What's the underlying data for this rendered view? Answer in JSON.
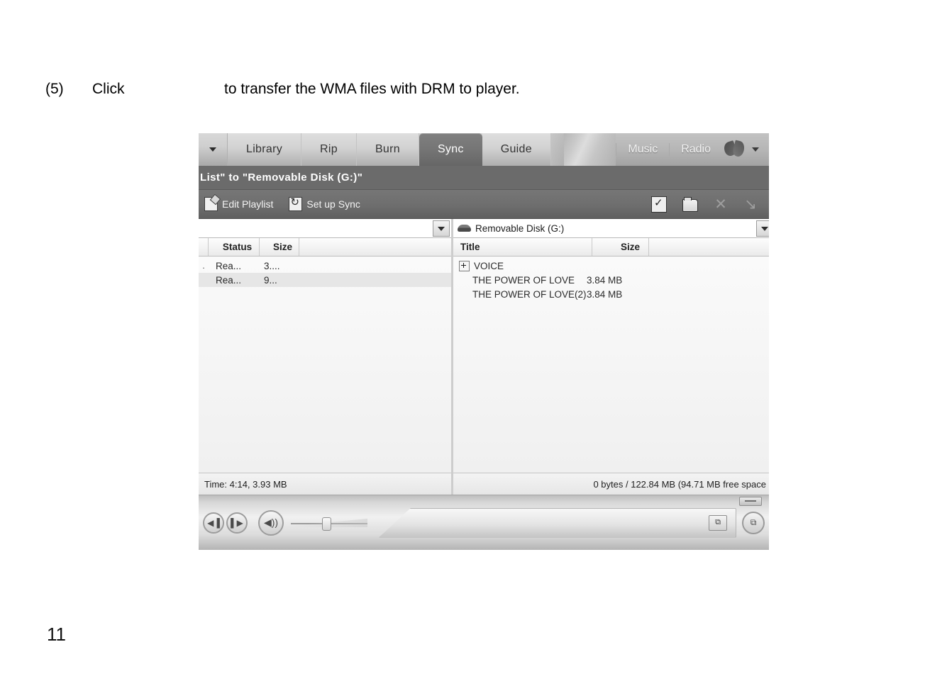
{
  "document": {
    "step_number": "(5)",
    "click_word": "Click",
    "instruction_rest": "to transfer the WMA files with DRM to player.",
    "page_number": "11"
  },
  "screenshot": {
    "tabbar": {
      "caret_icon": "caret-down-icon",
      "tabs": [
        {
          "label": "Library",
          "active": false
        },
        {
          "label": "Rip",
          "active": false
        },
        {
          "label": "Burn",
          "active": false
        },
        {
          "label": "Sync",
          "active": true
        },
        {
          "label": "Guide",
          "active": false
        }
      ],
      "links": [
        {
          "label": "Music"
        },
        {
          "label": "Radio"
        }
      ],
      "logo_icon": "butterfly-logo-icon",
      "links_caret_icon": "caret-down-icon"
    },
    "titlebar": {
      "text": "List\" to \"Removable Disk (G:)\""
    },
    "toolbar": {
      "edit_playlist_label": "Edit Playlist",
      "edit_playlist_icon": "edit-playlist-icon",
      "setup_sync_label": "Set up Sync",
      "setup_sync_icon": "setup-sync-icon",
      "right_icons": [
        {
          "name": "checked-document-icon",
          "glyph": ""
        },
        {
          "name": "open-folder-icon",
          "glyph": ""
        },
        {
          "name": "close-icon",
          "glyph": "✕"
        },
        {
          "name": "diagonal-arrow-icon",
          "glyph": "↘"
        }
      ]
    },
    "left_pane": {
      "combo_value": "",
      "combo_icon": "chevron-down-icon",
      "columns": {
        "status": "Status",
        "size": "Size"
      },
      "rows": [
        {
          "bullet": ".",
          "status": "Rea...",
          "size": "3....",
          "highlight": false
        },
        {
          "bullet": "",
          "status": "Rea...",
          "size": "9...",
          "highlight": true
        }
      ],
      "status_text": "Time: 4:14, 3.93 MB"
    },
    "right_pane": {
      "device_label": "Removable Disk (G:)",
      "device_icon": "removable-disk-icon",
      "combo_icon": "chevron-down-icon",
      "columns": {
        "title": "Title",
        "size": "Size"
      },
      "rows": [
        {
          "title": "VOICE",
          "size": "",
          "expandable": true,
          "indent": false
        },
        {
          "title": "THE POWER OF LOVE",
          "size": "3.84 MB",
          "expandable": false,
          "indent": true
        },
        {
          "title": "THE POWER OF LOVE(2)",
          "size": "3.84 MB",
          "expandable": false,
          "indent": true
        }
      ],
      "status_text": "0 bytes / 122.84 MB (94.71 MB free space"
    },
    "player": {
      "previous_icon": "previous-track-icon",
      "previous_glyph": "◀▐",
      "next_icon": "next-track-icon",
      "next_glyph": "▌▶",
      "volume_icon": "volume-speaker-icon",
      "volume_glyph": "◀))",
      "volume_slider": "volume-slider",
      "seek_icon": "switch-to-full-mode-icon",
      "seek_glyph": "⧉",
      "edge_icon": "now-playing-icon",
      "edge_glyph": "⧉",
      "mini_tab_icon": "resize-handle-icon"
    }
  }
}
